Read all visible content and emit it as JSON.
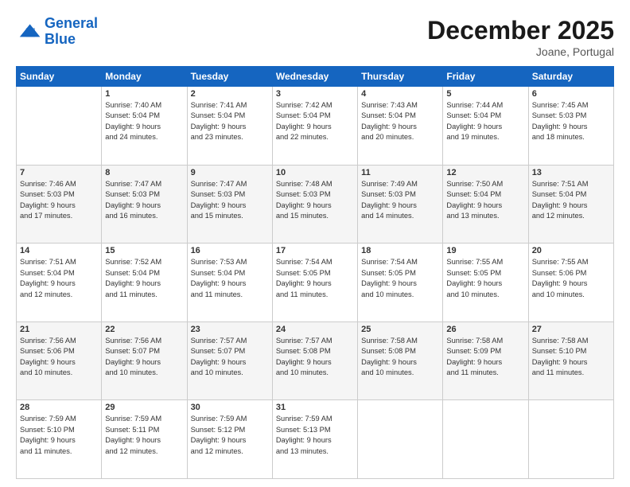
{
  "header": {
    "logo_line1": "General",
    "logo_line2": "Blue",
    "month": "December 2025",
    "location": "Joane, Portugal"
  },
  "weekdays": [
    "Sunday",
    "Monday",
    "Tuesday",
    "Wednesday",
    "Thursday",
    "Friday",
    "Saturday"
  ],
  "weeks": [
    [
      {
        "day": "",
        "text": ""
      },
      {
        "day": "1",
        "text": "Sunrise: 7:40 AM\nSunset: 5:04 PM\nDaylight: 9 hours\nand 24 minutes."
      },
      {
        "day": "2",
        "text": "Sunrise: 7:41 AM\nSunset: 5:04 PM\nDaylight: 9 hours\nand 23 minutes."
      },
      {
        "day": "3",
        "text": "Sunrise: 7:42 AM\nSunset: 5:04 PM\nDaylight: 9 hours\nand 22 minutes."
      },
      {
        "day": "4",
        "text": "Sunrise: 7:43 AM\nSunset: 5:04 PM\nDaylight: 9 hours\nand 20 minutes."
      },
      {
        "day": "5",
        "text": "Sunrise: 7:44 AM\nSunset: 5:04 PM\nDaylight: 9 hours\nand 19 minutes."
      },
      {
        "day": "6",
        "text": "Sunrise: 7:45 AM\nSunset: 5:03 PM\nDaylight: 9 hours\nand 18 minutes."
      }
    ],
    [
      {
        "day": "7",
        "text": "Sunrise: 7:46 AM\nSunset: 5:03 PM\nDaylight: 9 hours\nand 17 minutes."
      },
      {
        "day": "8",
        "text": "Sunrise: 7:47 AM\nSunset: 5:03 PM\nDaylight: 9 hours\nand 16 minutes."
      },
      {
        "day": "9",
        "text": "Sunrise: 7:47 AM\nSunset: 5:03 PM\nDaylight: 9 hours\nand 15 minutes."
      },
      {
        "day": "10",
        "text": "Sunrise: 7:48 AM\nSunset: 5:03 PM\nDaylight: 9 hours\nand 15 minutes."
      },
      {
        "day": "11",
        "text": "Sunrise: 7:49 AM\nSunset: 5:03 PM\nDaylight: 9 hours\nand 14 minutes."
      },
      {
        "day": "12",
        "text": "Sunrise: 7:50 AM\nSunset: 5:04 PM\nDaylight: 9 hours\nand 13 minutes."
      },
      {
        "day": "13",
        "text": "Sunrise: 7:51 AM\nSunset: 5:04 PM\nDaylight: 9 hours\nand 12 minutes."
      }
    ],
    [
      {
        "day": "14",
        "text": "Sunrise: 7:51 AM\nSunset: 5:04 PM\nDaylight: 9 hours\nand 12 minutes."
      },
      {
        "day": "15",
        "text": "Sunrise: 7:52 AM\nSunset: 5:04 PM\nDaylight: 9 hours\nand 11 minutes."
      },
      {
        "day": "16",
        "text": "Sunrise: 7:53 AM\nSunset: 5:04 PM\nDaylight: 9 hours\nand 11 minutes."
      },
      {
        "day": "17",
        "text": "Sunrise: 7:54 AM\nSunset: 5:05 PM\nDaylight: 9 hours\nand 11 minutes."
      },
      {
        "day": "18",
        "text": "Sunrise: 7:54 AM\nSunset: 5:05 PM\nDaylight: 9 hours\nand 10 minutes."
      },
      {
        "day": "19",
        "text": "Sunrise: 7:55 AM\nSunset: 5:05 PM\nDaylight: 9 hours\nand 10 minutes."
      },
      {
        "day": "20",
        "text": "Sunrise: 7:55 AM\nSunset: 5:06 PM\nDaylight: 9 hours\nand 10 minutes."
      }
    ],
    [
      {
        "day": "21",
        "text": "Sunrise: 7:56 AM\nSunset: 5:06 PM\nDaylight: 9 hours\nand 10 minutes."
      },
      {
        "day": "22",
        "text": "Sunrise: 7:56 AM\nSunset: 5:07 PM\nDaylight: 9 hours\nand 10 minutes."
      },
      {
        "day": "23",
        "text": "Sunrise: 7:57 AM\nSunset: 5:07 PM\nDaylight: 9 hours\nand 10 minutes."
      },
      {
        "day": "24",
        "text": "Sunrise: 7:57 AM\nSunset: 5:08 PM\nDaylight: 9 hours\nand 10 minutes."
      },
      {
        "day": "25",
        "text": "Sunrise: 7:58 AM\nSunset: 5:08 PM\nDaylight: 9 hours\nand 10 minutes."
      },
      {
        "day": "26",
        "text": "Sunrise: 7:58 AM\nSunset: 5:09 PM\nDaylight: 9 hours\nand 11 minutes."
      },
      {
        "day": "27",
        "text": "Sunrise: 7:58 AM\nSunset: 5:10 PM\nDaylight: 9 hours\nand 11 minutes."
      }
    ],
    [
      {
        "day": "28",
        "text": "Sunrise: 7:59 AM\nSunset: 5:10 PM\nDaylight: 9 hours\nand 11 minutes."
      },
      {
        "day": "29",
        "text": "Sunrise: 7:59 AM\nSunset: 5:11 PM\nDaylight: 9 hours\nand 12 minutes."
      },
      {
        "day": "30",
        "text": "Sunrise: 7:59 AM\nSunset: 5:12 PM\nDaylight: 9 hours\nand 12 minutes."
      },
      {
        "day": "31",
        "text": "Sunrise: 7:59 AM\nSunset: 5:13 PM\nDaylight: 9 hours\nand 13 minutes."
      },
      {
        "day": "",
        "text": ""
      },
      {
        "day": "",
        "text": ""
      },
      {
        "day": "",
        "text": ""
      }
    ]
  ]
}
